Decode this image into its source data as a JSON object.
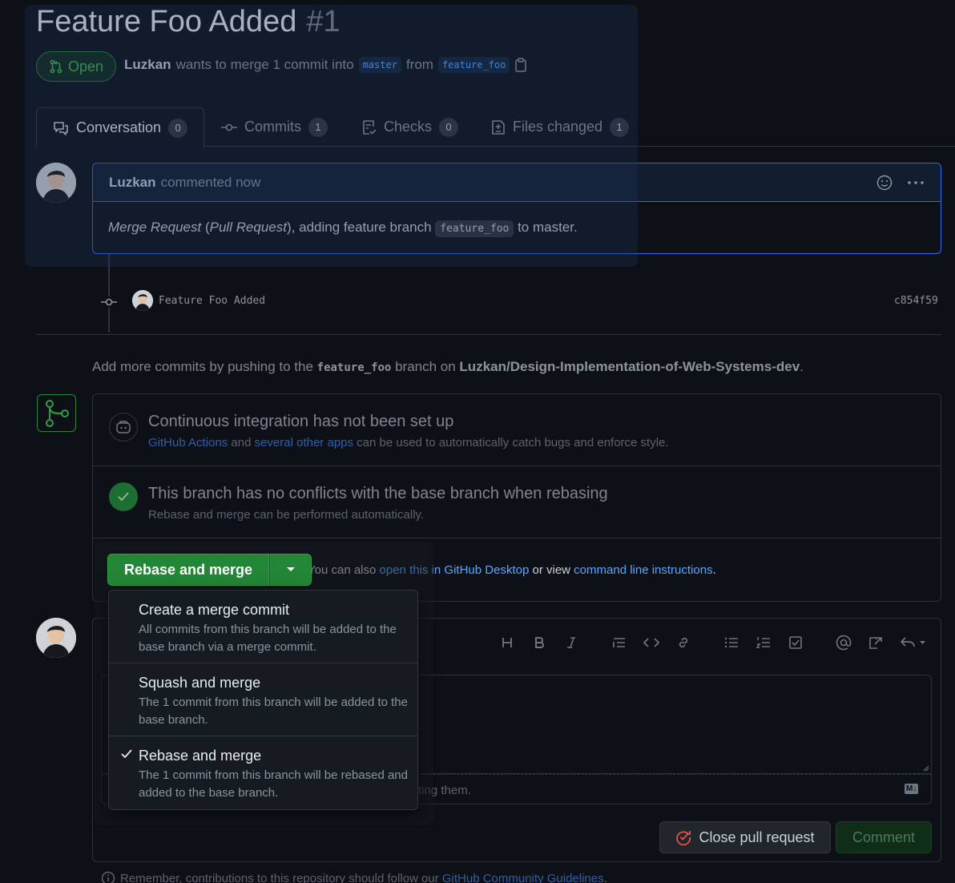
{
  "pr": {
    "title": "Feature Foo Added",
    "number": "#1",
    "state": "Open",
    "author": "Luzkan",
    "merge_text": "wants to merge 1 commit into",
    "base_branch": "master",
    "from_text": "from",
    "head_branch": "feature_foo"
  },
  "tabs": [
    {
      "label": "Conversation",
      "count": "0"
    },
    {
      "label": "Commits",
      "count": "1"
    },
    {
      "label": "Checks",
      "count": "0"
    },
    {
      "label": "Files changed",
      "count": "1"
    }
  ],
  "comment": {
    "author": "Luzkan",
    "time": "commented now",
    "body_italic_1": "Merge Request",
    "body_paren_open": " (",
    "body_italic_2": "Pull Request",
    "body_mid": "), adding feature branch ",
    "body_code": "feature_foo",
    "body_end": " to master."
  },
  "commit": {
    "message": "Feature Foo Added",
    "sha": "c854f59"
  },
  "hint": {
    "pre": "Add more commits by pushing to the ",
    "branch": "feature_foo",
    "mid": " branch on ",
    "repo": "Luzkan/Design-Implementation-of-Web-Systems-dev",
    "end": "."
  },
  "ci": {
    "title": "Continuous integration has not been set up",
    "link1": "GitHub Actions",
    "and": " and ",
    "link2": "several other apps",
    "rest": " can be used to automatically catch bugs and enforce style."
  },
  "conflicts": {
    "title": "This branch has no conflicts with the base branch when rebasing",
    "subtitle": "Rebase and merge can be performed automatically."
  },
  "merge_button": {
    "label": "Rebase and merge"
  },
  "also": {
    "pre": "You can also ",
    "link1": "open this in GitHub Desktop",
    "mid": " or view ",
    "link2": "command line instructions",
    "end": "."
  },
  "merge_options": [
    {
      "title": "Create a merge commit",
      "desc": "All commits from this branch will be added to the base branch via a merge commit.",
      "selected": false
    },
    {
      "title": "Squash and merge",
      "desc": "The 1 commit from this branch will be added to the base branch.",
      "selected": false
    },
    {
      "title": "Rebase and merge",
      "desc": "The 1 commit from this branch will be rebased and added to the base branch.",
      "selected": true
    }
  ],
  "editor": {
    "attach_partial": "ting them.",
    "md_badge": "M↓"
  },
  "buttons": {
    "close": "Close pull request",
    "comment": "Comment"
  },
  "footer": {
    "pre": "Remember, contributions to this repository should follow our ",
    "link": "GitHub Community Guidelines",
    "end": "."
  },
  "colors": {
    "accent": "#1f6feb",
    "success": "#238636",
    "link": "#58a6ff",
    "danger": "#f85149"
  }
}
